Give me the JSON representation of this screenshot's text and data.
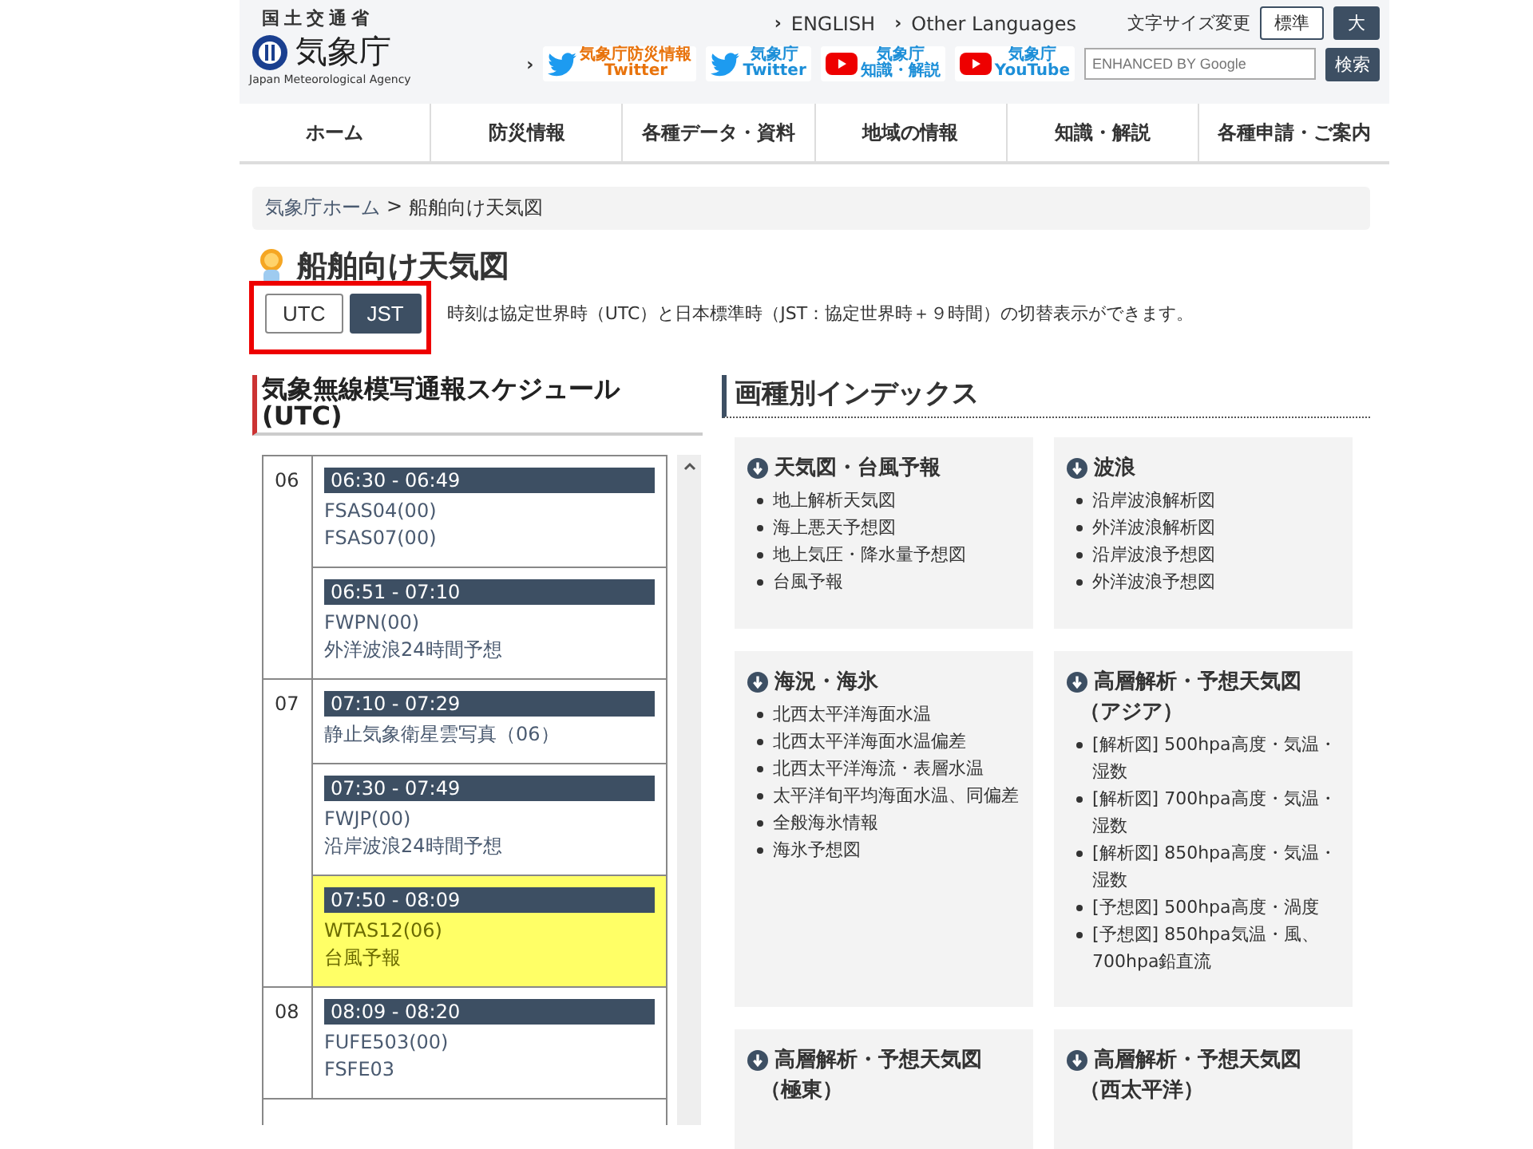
{
  "header": {
    "agency_line": "国土交通省",
    "logo_text": "気象庁",
    "logo_subtitle": "Japan Meteorological Agency",
    "language_links": [
      {
        "marker": "›",
        "label": "ENGLISH"
      },
      {
        "marker": "›",
        "label": "Other Languages"
      }
    ],
    "social_marker": "›",
    "font_size_label": "文字サイズ変更",
    "font_sizes": [
      {
        "label": "標準",
        "selected": true
      },
      {
        "label": "大",
        "selected": false
      }
    ],
    "social_links": [
      {
        "kind": "twitter",
        "line1": "気象庁防災情報",
        "line2": "Twitter",
        "color": "#e8730c"
      },
      {
        "kind": "twitter",
        "line1": "気象庁",
        "line2": "Twitter",
        "color": "#1d8fd8"
      },
      {
        "kind": "youtube",
        "line1": "気象庁",
        "line2": "知識・解説",
        "color": "#1d8fd8"
      },
      {
        "kind": "youtube",
        "line1": "気象庁",
        "line2": "YouTube",
        "color": "#1d8fd8"
      }
    ],
    "search": {
      "placeholder": "ENHANCED BY Google",
      "button": "検索"
    }
  },
  "nav": [
    "ホーム",
    "防災情報",
    "各種データ・資料",
    "地域の情報",
    "知識・解説",
    "各種申請・ご案内"
  ],
  "breadcrumb": {
    "items": [
      "気象庁ホーム",
      "船舶向け天気図"
    ],
    "separator": ">"
  },
  "page_title": "船舶向け天気図",
  "time_toggle": [
    {
      "label": "UTC",
      "selected": true
    },
    {
      "label": "JST",
      "selected": false
    }
  ],
  "description": "時刻は協定世界時（UTC）と日本標準時（JST：協定世界時＋９時間）の切替表示ができます。",
  "schedule": {
    "title": "気象無線模写通報スケジュール",
    "title_line2": "(UTC)",
    "hours": [
      {
        "hour": "06",
        "slots": [
          {
            "time": "06:30 - 06:49",
            "lines": [
              "FSAS04(00)",
              "FSAS07(00)"
            ],
            "highlighted": false
          },
          {
            "time": "06:51 - 07:10",
            "lines": [
              "FWPN(00)",
              "外洋波浪24時間予想"
            ],
            "highlighted": false
          }
        ]
      },
      {
        "hour": "07",
        "slots": [
          {
            "time": "07:10 - 07:29",
            "lines": [
              "静止気象衛星雲写真（06）"
            ],
            "highlighted": false
          },
          {
            "time": "07:30 - 07:49",
            "lines": [
              "FWJP(00)",
              "沿岸波浪24時間予想"
            ],
            "highlighted": false
          },
          {
            "time": "07:50 - 08:09",
            "lines": [
              "WTAS12(06)",
              "台風予報"
            ],
            "highlighted": true
          }
        ]
      },
      {
        "hour": "08",
        "slots": [
          {
            "time": "08:09 - 08:20",
            "lines": [
              "FUFE503(00)",
              "FSFE03"
            ],
            "highlighted": false
          }
        ]
      }
    ]
  },
  "index": {
    "title": "画種別インデックス",
    "cards": [
      {
        "title": "天気図・台風予報",
        "items": [
          "地上解析天気図",
          "海上悪天予想図",
          "地上気圧・降水量予想図",
          "台風予報"
        ]
      },
      {
        "title": "波浪",
        "items": [
          "沿岸波浪解析図",
          "外洋波浪解析図",
          "沿岸波浪予想図",
          "外洋波浪予想図"
        ]
      },
      {
        "title": "海況・海氷",
        "items": [
          "北西太平洋海面水温",
          "北西太平洋海面水温偏差",
          "北西太平洋海流・表層水温",
          "太平洋旬平均海面水温、同偏差",
          "全般海氷情報",
          "海氷予想図"
        ]
      },
      {
        "title": "高層解析・予想天気図",
        "title_note": "（アジア）",
        "items": [
          "[解析図] 500hpa高度・気温・湿数",
          "[解析図] 700hpa高度・気温・湿数",
          "[解析図] 850hpa高度・気温・湿数",
          "[予想図] 500hpa高度・渦度",
          "[予想図] 850hpa気温・風、700hpa鉛直流"
        ]
      },
      {
        "title": "高層解析・予想天気図",
        "title_note": "（極東）"
      },
      {
        "title": "高層解析・予想天気図",
        "title_note": "（西太平洋）"
      }
    ]
  }
}
